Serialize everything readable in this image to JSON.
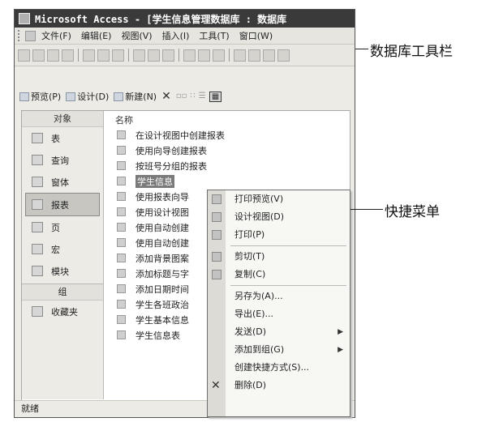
{
  "window": {
    "title": "Microsoft Access - [学生信息管理数据库 : 数据库"
  },
  "menubar": {
    "items": [
      "文件(F)",
      "编辑(E)",
      "视图(V)",
      "插入(I)",
      "工具(T)",
      "窗口(W)"
    ]
  },
  "db_toolbar": {
    "preview": "预览(P)",
    "design": "设计(D)",
    "new": "新建(N)",
    "delete": "✕"
  },
  "objects_panel": {
    "header": "对象",
    "items": [
      "表",
      "查询",
      "窗体",
      "报表",
      "页",
      "宏",
      "模块"
    ],
    "selected": "报表",
    "groups_header": "组",
    "groups": [
      "收藏夹"
    ]
  },
  "list": {
    "header": "名称",
    "items": [
      "在设计视图中创建报表",
      "使用向导创建报表",
      "按班号分组的报表",
      "学生信息",
      "使用报表向导",
      "使用设计视图",
      "使用自动创建",
      "使用自动创建",
      "添加背景图案",
      "添加标题与字",
      "添加日期时间",
      "学生各班政治",
      "学生基本信息",
      "学生信息表"
    ],
    "selected_index": 3
  },
  "status": "就绪",
  "context_menu": {
    "items": [
      {
        "label": "打印预览(V)",
        "submenu": false
      },
      {
        "label": "设计视图(D)",
        "submenu": false
      },
      {
        "label": "打印(P)",
        "submenu": false
      },
      {
        "sep": true
      },
      {
        "label": "剪切(T)",
        "submenu": false
      },
      {
        "label": "复制(C)",
        "submenu": false
      },
      {
        "sep": true
      },
      {
        "label": "另存为(A)...",
        "submenu": false
      },
      {
        "label": "导出(E)...",
        "submenu": false
      },
      {
        "label": "发送(D)",
        "submenu": true
      },
      {
        "label": "添加到组(G)",
        "submenu": true
      },
      {
        "label": "创建快捷方式(S)...",
        "submenu": false
      },
      {
        "label": "删除(D)",
        "submenu": false
      }
    ]
  },
  "annotations": {
    "toolbar_label": "数据库工具栏",
    "menu_label": "快捷菜单"
  }
}
